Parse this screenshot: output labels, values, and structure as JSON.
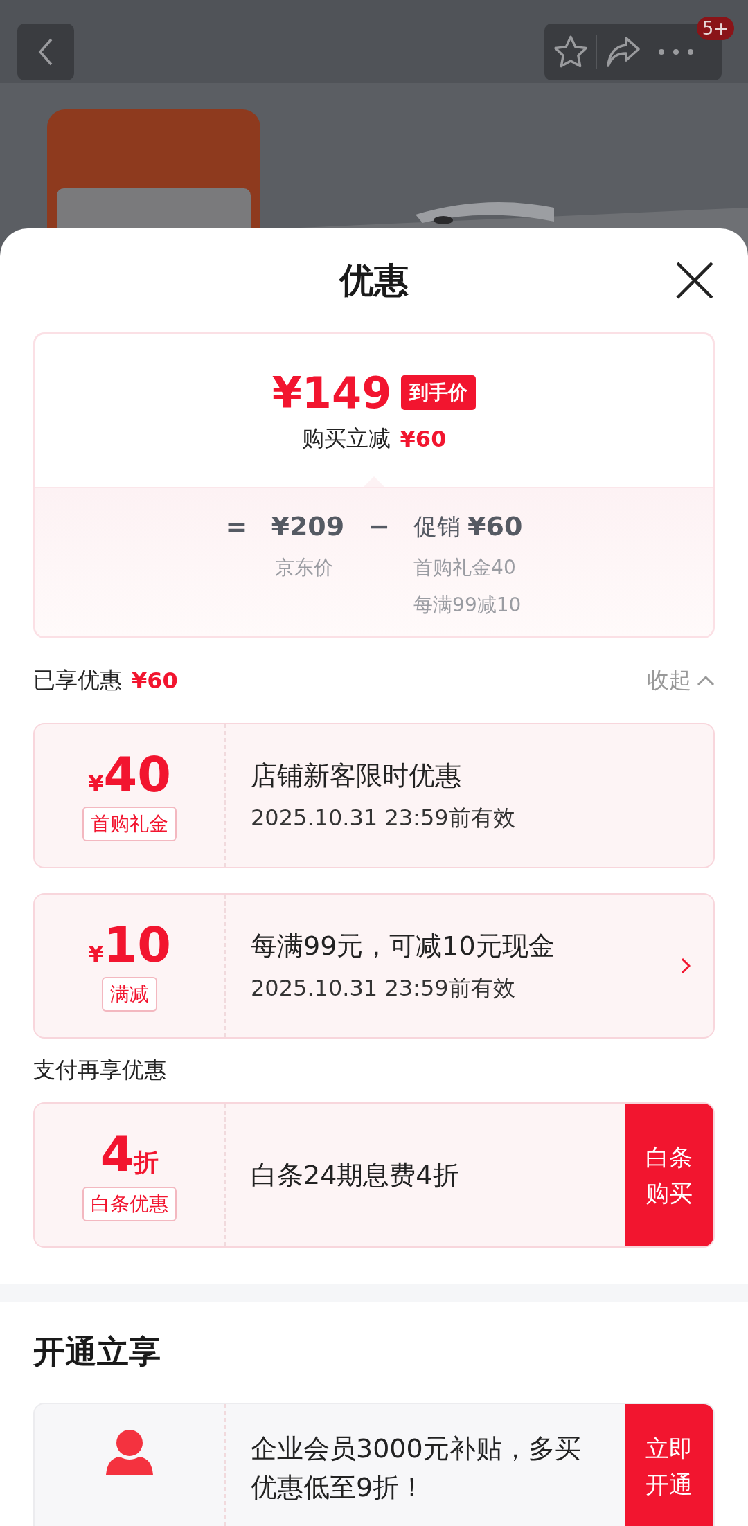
{
  "top_bar": {
    "badge": "5+"
  },
  "sheet": {
    "title": "优惠"
  },
  "price_summary": {
    "final_price": "¥149",
    "final_tag": "到手价",
    "instant_cut_label": "购买立减",
    "instant_cut_amount": "¥60",
    "equals": "=",
    "base_price": "¥209",
    "base_label": "京东价",
    "minus": "−",
    "promo_label": "促销",
    "promo_amount": "¥60",
    "promo_items": [
      "首购礼金40",
      "每满99减10"
    ]
  },
  "enjoyed": {
    "label": "已享优惠",
    "amount": "¥60",
    "toggle": "收起",
    "expanded": true
  },
  "coupons": [
    {
      "kind": "plain",
      "currency": "¥",
      "amount": "40",
      "tag": "首购礼金",
      "title": "店铺新客限时优惠",
      "validity": "2025.10.31 23:59前有效"
    },
    {
      "kind": "link",
      "currency": "¥",
      "amount": "10",
      "tag": "满减",
      "title": "每满99元，可减10元现金",
      "validity": "2025.10.31 23:59前有效"
    }
  ],
  "pay_section": {
    "title": "支付再享优惠",
    "offers": [
      {
        "amount": "4",
        "unit": "折",
        "tag": "白条优惠",
        "title": "白条24期息费4折",
        "action": "白条购买"
      }
    ]
  },
  "open_section": {
    "title": "开通立享",
    "offers": [
      {
        "kind": "member",
        "text": "企业会员3000元补贴，多买优惠低至9折！",
        "action": "立即开通"
      }
    ]
  }
}
